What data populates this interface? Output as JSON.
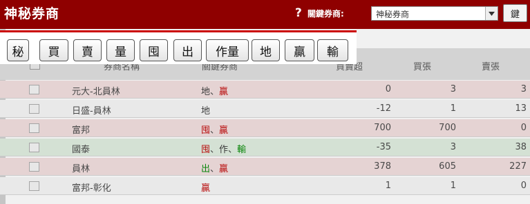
{
  "header": {
    "title": "神秘券商",
    "help_icon": "question-mark-icon",
    "filter_label": "關鍵券商:",
    "select_value": "神秘券商",
    "go_button": "鍵"
  },
  "overlay_buttons": [
    "秘",
    "買",
    "賣",
    "量",
    "囤",
    "出",
    "作量",
    "地",
    "贏",
    "輸"
  ],
  "table": {
    "columns": [
      "券商名稱",
      "關鍵券商",
      "買賣超",
      "買張",
      "賣張"
    ],
    "rows": [
      {
        "name": "元大-北員林",
        "tags": [
          {
            "t": "地",
            "c": "dark"
          },
          {
            "t": "贏",
            "c": "red"
          }
        ],
        "net": "0",
        "buy": "3",
        "sell": "3"
      },
      {
        "name": "日盛-員林",
        "tags": [
          {
            "t": "地",
            "c": "dark"
          }
        ],
        "net": "-12",
        "buy": "1",
        "sell": "13"
      },
      {
        "name": "富邦",
        "tags": [
          {
            "t": "囤",
            "c": "red"
          },
          {
            "t": "贏",
            "c": "red"
          }
        ],
        "net": "700",
        "buy": "700",
        "sell": "0"
      },
      {
        "name": "國泰",
        "tags": [
          {
            "t": "囤",
            "c": "red"
          },
          {
            "t": "作",
            "c": "dark"
          },
          {
            "t": "輸",
            "c": "green"
          }
        ],
        "net": "-35",
        "buy": "3",
        "sell": "38"
      },
      {
        "name": "員林",
        "tags": [
          {
            "t": "出",
            "c": "green"
          },
          {
            "t": "贏",
            "c": "red"
          }
        ],
        "net": "378",
        "buy": "605",
        "sell": "227"
      },
      {
        "name": "富邦-彰化",
        "tags": [
          {
            "t": "贏",
            "c": "red"
          }
        ],
        "net": "1",
        "buy": "1",
        "sell": "0"
      }
    ]
  },
  "colors": {
    "header_bg": "#8f0000",
    "row_pink": "#f2dede",
    "row_green": "#dfeedf",
    "row_white": "#f7f7f7",
    "overlay_border": "#cc0000"
  }
}
